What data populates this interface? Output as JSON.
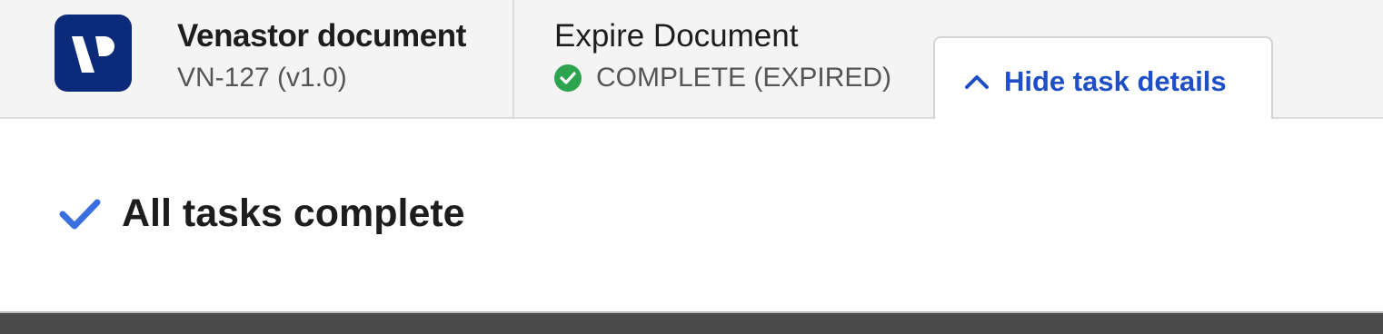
{
  "header": {
    "logo_icon": "venastor-logo-icon",
    "document": {
      "title": "Venastor document",
      "id_version": "VN-127 (v1.0)"
    },
    "task": {
      "title": "Expire Document",
      "status_icon": "check-circle-icon",
      "status": "COMPLETE (EXPIRED)",
      "status_color": "#2ea44f"
    },
    "toggle": {
      "icon": "chevron-up-icon",
      "label": "Hide task details",
      "color": "#1f4fc6"
    }
  },
  "details": {
    "icon": "checkmark-icon",
    "message": "All tasks complete",
    "icon_color": "#3a6fe0"
  },
  "colors": {
    "brand": "#0b2a7a",
    "header_bg": "#f4f4f4",
    "footer_bg": "#4a4a4a"
  }
}
